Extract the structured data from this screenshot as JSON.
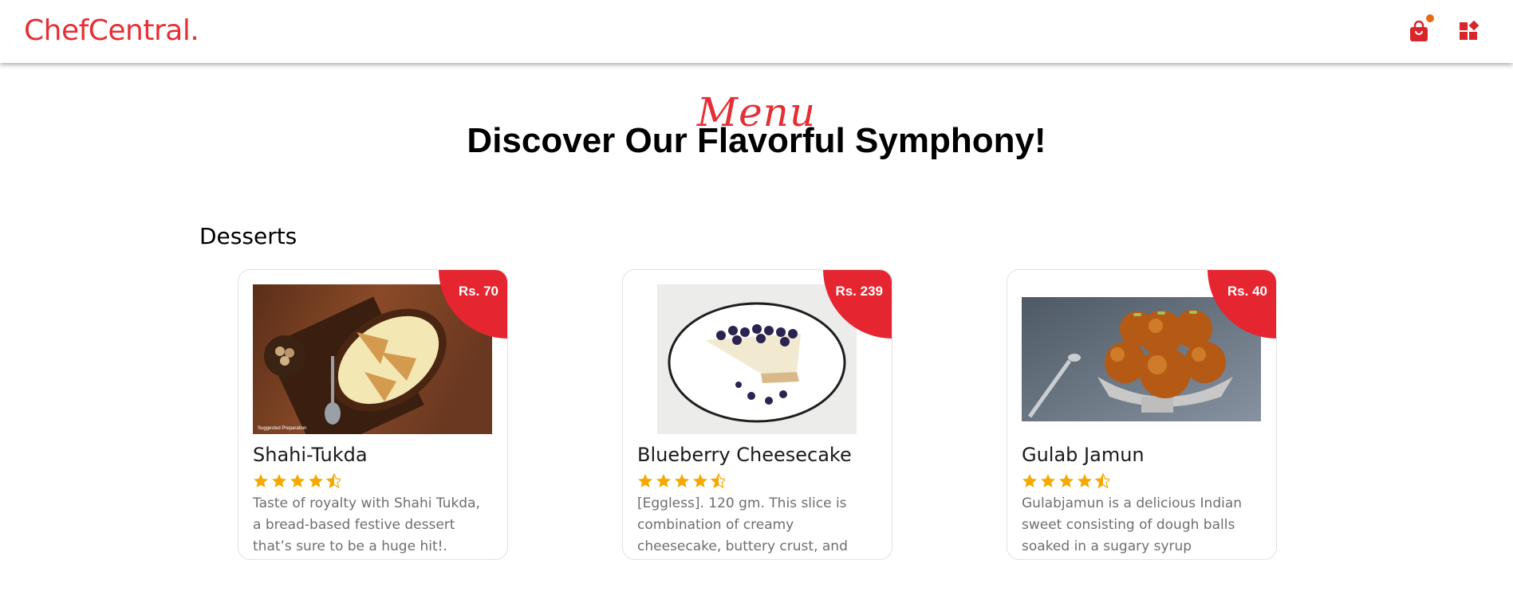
{
  "header": {
    "brand": "ChefCentral.",
    "cart_icon": "shopping-bag-icon",
    "apps_icon": "widgets-icon",
    "accent_color": "#e52f35",
    "badge_color": "#ea6a12"
  },
  "hero": {
    "script": "Menu",
    "title": "Discover Our Flavorful Symphony!"
  },
  "section": {
    "title": "Desserts"
  },
  "items": [
    {
      "price": "Rs. 70",
      "name": "Shahi-Tukda",
      "rating": 4.5,
      "description": "Taste of royalty with Shahi Tukda, a bread-based festive dessert that’s sure to be a huge hit!.",
      "photo_caption": "Suggested Preparation"
    },
    {
      "price": "Rs. 239",
      "name": "Blueberry Cheesecake",
      "rating": 4.5,
      "description": "[Eggless]. 120 gm. This slice is combination of creamy cheesecake, buttery crust, and vibrant blueberry"
    },
    {
      "price": "Rs. 40",
      "name": "Gulab Jamun",
      "rating": 4.5,
      "description": "Gulabjamun is a delicious Indian sweet consisting of dough balls soaked in a sugary syrup"
    }
  ],
  "colors": {
    "price_badge": "#e52530",
    "star": "#f5a800"
  }
}
